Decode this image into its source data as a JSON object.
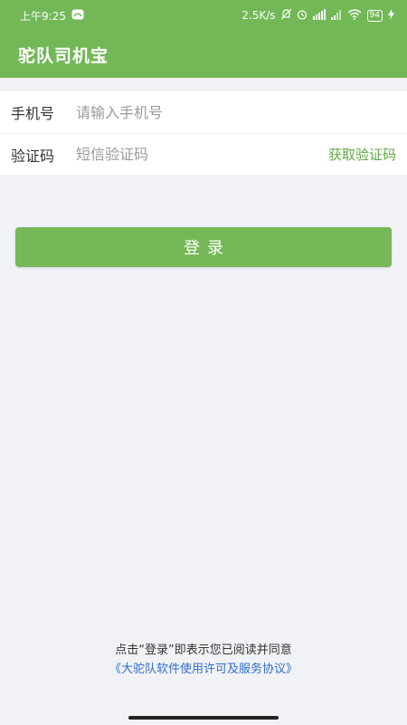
{
  "status_bar": {
    "time": "上午9:25",
    "network_speed": "2.5K/s",
    "battery": "94",
    "icons": [
      "notification-icon",
      "mute-icon",
      "alarm-icon",
      "hd-signal-icon",
      "signal-icon",
      "wifi-icon",
      "battery-icon",
      "charging-icon"
    ]
  },
  "app_bar": {
    "title": "驼队司机宝"
  },
  "form": {
    "phone_label": "手机号",
    "phone_placeholder": "请输入手机号",
    "phone_value": "",
    "code_label": "验证码",
    "code_placeholder": "短信验证码",
    "code_value": "",
    "get_code_label": "获取验证码"
  },
  "login_button": {
    "label": "登录"
  },
  "agreement": {
    "text": "点击“登录”即表示您已阅读并同意",
    "link": "《大驼队软件使用许可及服务协议》"
  },
  "colors": {
    "brand_green": "#72b856",
    "link_green": "#5fa845",
    "link_blue": "#2f6fcf",
    "background": "#f1f2f6"
  }
}
